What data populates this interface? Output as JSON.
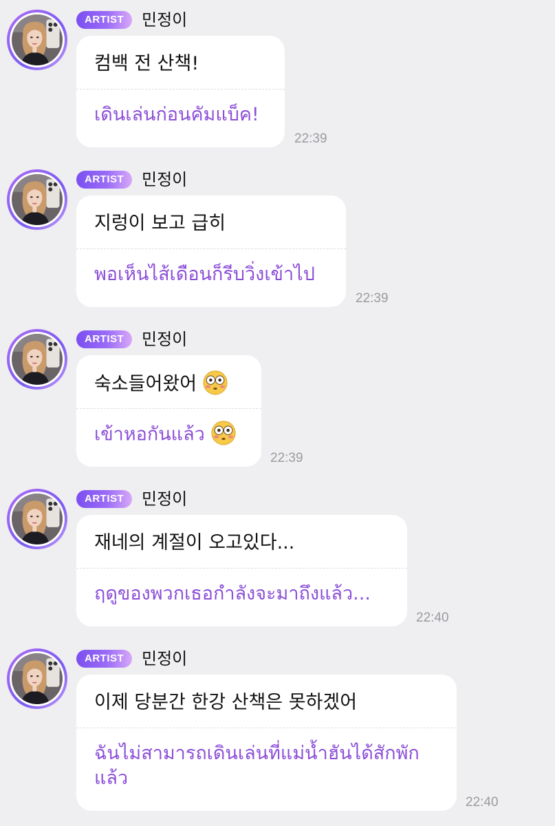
{
  "messages": [
    {
      "badge": "ARTIST",
      "name": "민정이",
      "original": "컴백 전 산책!",
      "translation": "เดินเล่นก่อนคัมแบ็ค!",
      "time": "22:39"
    },
    {
      "badge": "ARTIST",
      "name": "민정이",
      "original": "지렁이 보고 급히",
      "translation": "พอเห็นไส้เดือนก็รีบวิ่งเข้าไป",
      "time": "22:39"
    },
    {
      "badge": "ARTIST",
      "name": "민정이",
      "original": "숙소들어왔어",
      "translation": "เข้าหอกันแล้ว",
      "time": "22:39",
      "emoji": "flushed-face-emoji"
    },
    {
      "badge": "ARTIST",
      "name": "민정이",
      "original": "재네의 계절이 오고있다...",
      "translation": "ฤดูของพวกเธอกำลังจะมาถึงแล้ว...",
      "time": "22:40"
    },
    {
      "badge": "ARTIST",
      "name": "민정이",
      "original": "이제 당분간 한강 산책은 못하겠어",
      "translation_line1": "ฉันไม่สามารถเดินเล่นที่แม่น้ำฮันได้สักพัก",
      "translation_line2": "แล้ว",
      "time": "22:40"
    }
  ],
  "colors": {
    "background": "#efeff1",
    "bubble": "#ffffff",
    "translation_text": "#8c4fd8",
    "badge_gradient_start": "#7b4ff0",
    "badge_gradient_end": "#d8a8f8",
    "timestamp": "#9a9aa0"
  }
}
